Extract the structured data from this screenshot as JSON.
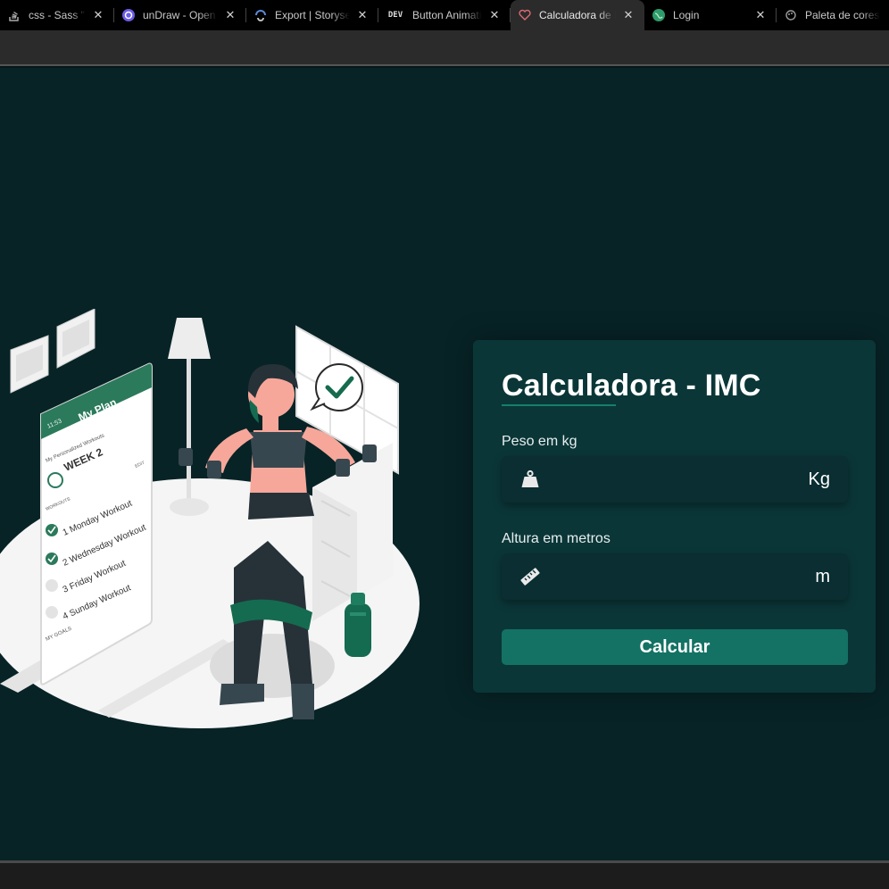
{
  "browser": {
    "tabs": [
      {
        "title": "css - Sass \"Error: ",
        "icon": "stackoverflow-icon"
      },
      {
        "title": "unDraw - Open source",
        "icon": "undraw-icon"
      },
      {
        "title": "Export | Storyset",
        "icon": "storyset-icon"
      },
      {
        "title": "Button Animations",
        "icon": "dev-icon",
        "prefix": "DEV"
      },
      {
        "title": "Calculadora de IMC",
        "icon": "heart-icon",
        "active": true
      },
      {
        "title": "Login",
        "icon": "globe-icon"
      },
      {
        "title": "Paleta de cores",
        "icon": "palette-icon"
      }
    ],
    "close_glyph": "✕"
  },
  "illustration": {
    "phone_status": "11:53",
    "phone_title": "My Plan",
    "subtitle": "My Personalized Workouts",
    "week": "WEEK 2",
    "edit": "EDIT",
    "workouts_label": "WORKOUTS",
    "items": [
      "1 Monday Workout",
      "2 Wednesday Workout",
      "3 Friday Workout",
      "4 Sunday Workout"
    ],
    "goals": "MY GOALS"
  },
  "form": {
    "title": "Calculadora - IMC",
    "weight_label": "Peso em kg",
    "weight_value": "",
    "weight_unit": "Kg",
    "height_label": "Altura em metros",
    "height_value": "",
    "height_unit": "m",
    "submit_label": "Calcular"
  },
  "colors": {
    "background": "#072326",
    "card": "#0b3638",
    "input": "#0a2e31",
    "accent": "#137264"
  }
}
